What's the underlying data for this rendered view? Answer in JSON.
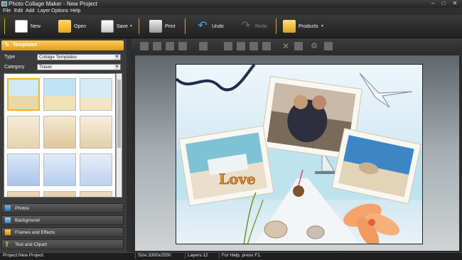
{
  "window": {
    "title": "Photo Collage Maker - New Project"
  },
  "menu": [
    "File",
    "Edit",
    "Add",
    "Layer",
    "Options",
    "Help"
  ],
  "toolbar": {
    "new_label": "New",
    "open_label": "Open",
    "save_label": "Save",
    "print_label": "Print",
    "undo_label": "Undo",
    "redo_label": "Redo",
    "products_label": "Products"
  },
  "panel": {
    "templates_label": "Templates",
    "type_label": "Type",
    "type_value": "Collage Templates",
    "category_label": "Category",
    "category_value": "Travel",
    "sections": [
      "Photos",
      "Background",
      "Frames and Effects",
      "Text and Clipart"
    ]
  },
  "canvas": {
    "love_text": "Love"
  },
  "status": {
    "project": "Project:New Project",
    "size": "Size:3300x2550",
    "layers": "Layers:12",
    "help": "For Help, press F1."
  },
  "colors": {
    "accent": "#e9a21b",
    "brand": "#ffce5c"
  }
}
